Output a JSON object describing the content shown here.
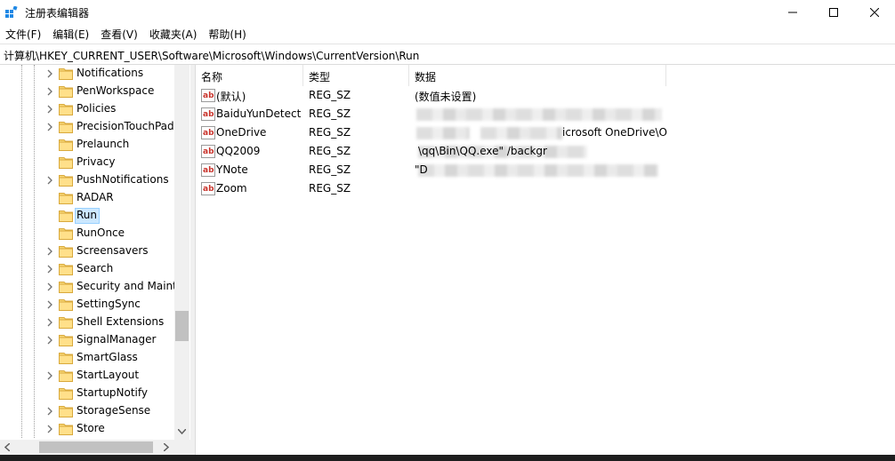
{
  "window": {
    "title": "注册表编辑器"
  },
  "menu": [
    "文件(F)",
    "编辑(E)",
    "查看(V)",
    "收藏夹(A)",
    "帮助(H)"
  ],
  "address": "计算机\\HKEY_CURRENT_USER\\Software\\Microsoft\\Windows\\CurrentVersion\\Run",
  "tree": {
    "selected": "Run",
    "items": [
      {
        "label": "Notifications",
        "expandable": true
      },
      {
        "label": "PenWorkspace",
        "expandable": true
      },
      {
        "label": "Policies",
        "expandable": true
      },
      {
        "label": "PrecisionTouchPad",
        "expandable": true
      },
      {
        "label": "Prelaunch",
        "expandable": false
      },
      {
        "label": "Privacy",
        "expandable": false
      },
      {
        "label": "PushNotifications",
        "expandable": true
      },
      {
        "label": "RADAR",
        "expandable": false
      },
      {
        "label": "Run",
        "expandable": false
      },
      {
        "label": "RunOnce",
        "expandable": false
      },
      {
        "label": "Screensavers",
        "expandable": true
      },
      {
        "label": "Search",
        "expandable": true
      },
      {
        "label": "Security and Mainte",
        "expandable": true
      },
      {
        "label": "SettingSync",
        "expandable": true
      },
      {
        "label": "Shell Extensions",
        "expandable": true
      },
      {
        "label": "SignalManager",
        "expandable": true
      },
      {
        "label": "SmartGlass",
        "expandable": false
      },
      {
        "label": "StartLayout",
        "expandable": true
      },
      {
        "label": "StartupNotify",
        "expandable": false
      },
      {
        "label": "StorageSense",
        "expandable": true
      },
      {
        "label": "Store",
        "expandable": true
      }
    ]
  },
  "list": {
    "columns": [
      "名称",
      "类型",
      "数据"
    ],
    "rows": [
      {
        "name": "(默认)",
        "type": "REG_SZ",
        "data": "(数值未设置)"
      },
      {
        "name": "BaiduYunDetect",
        "type": "REG_SZ",
        "data": ""
      },
      {
        "name": "OneDrive",
        "type": "REG_SZ",
        "data": "icrosoft OneDrive\\O..."
      },
      {
        "name": "QQ2009",
        "type": "REG_SZ",
        "data": "\\qq\\Bin\\QQ.exe\" /backgr"
      },
      {
        "name": "YNote",
        "type": "REG_SZ",
        "data": "\"D"
      },
      {
        "name": "Zoom",
        "type": "REG_SZ",
        "data": ""
      }
    ]
  },
  "colors": {
    "selection_bg": "#cce8ff",
    "selection_border": "#99d1ff",
    "folder": "#f5c542",
    "ab_red": "#c8322a"
  }
}
